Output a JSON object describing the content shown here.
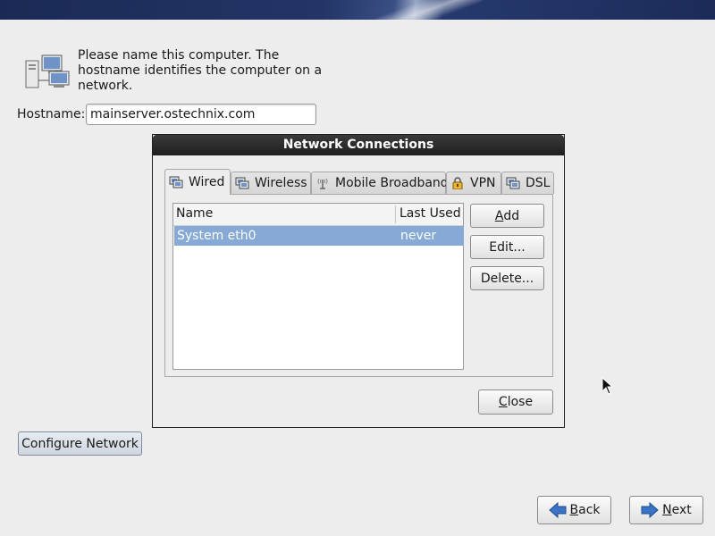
{
  "intro": {
    "line1": "Please name this computer.  The",
    "line2": "hostname identifies the computer on a",
    "line3": "network."
  },
  "hostname": {
    "label": "Hostname:",
    "value": "mainserver.ostechnix.com"
  },
  "dialog": {
    "title": "Network Connections",
    "tabs": [
      {
        "label": "Wired",
        "icon": "wired-icon",
        "active": true
      },
      {
        "label": "Wireless",
        "icon": "wireless-icon",
        "active": false
      },
      {
        "label": "Mobile Broadband",
        "icon": "mobile-broadband-icon",
        "active": false
      },
      {
        "label": "VPN",
        "icon": "vpn-lock-icon",
        "active": false
      },
      {
        "label": "DSL",
        "icon": "dsl-icon",
        "active": false
      }
    ],
    "columns": {
      "name": "Name",
      "last_used": "Last Used"
    },
    "rows": [
      {
        "name": "System eth0",
        "last_used": "never",
        "selected": true
      }
    ],
    "buttons": {
      "add_pre": "",
      "add_u": "A",
      "add_post": "dd",
      "edit": "Edit...",
      "delete": "Delete..."
    },
    "close": {
      "u": "C",
      "rest": "lose"
    }
  },
  "configure_network": "Configure Network",
  "back": {
    "u": "B",
    "rest": "ack"
  },
  "next": {
    "u": "N",
    "rest": "ext"
  },
  "colors": {
    "selection": "#86a9d6",
    "titlebar": "#2a2a2a",
    "arrow": "#3b74c4"
  }
}
